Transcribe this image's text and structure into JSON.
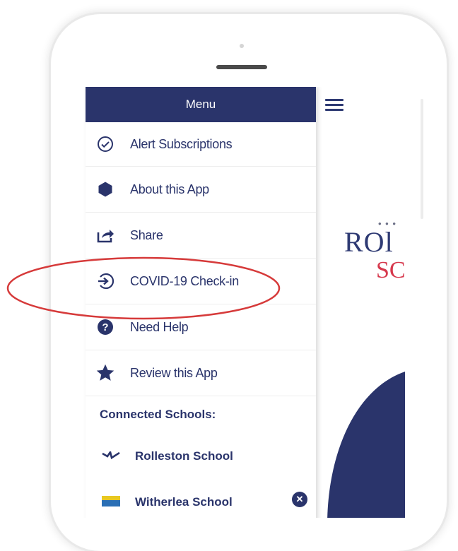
{
  "drawer": {
    "title": "Menu",
    "items": [
      {
        "label": "Alert Subscriptions",
        "icon": "check-circle-icon"
      },
      {
        "label": "About this App",
        "icon": "hexagon-icon"
      },
      {
        "label": "Share",
        "icon": "share-icon"
      },
      {
        "label": "COVID-19 Check-in",
        "icon": "sign-in-icon"
      },
      {
        "label": "Need Help",
        "icon": "question-icon"
      },
      {
        "label": "Review this App",
        "icon": "star-icon"
      }
    ],
    "connected_title": "Connected Schools:",
    "schools": [
      {
        "label": "Rolleston School",
        "icon": "school-logo-icon"
      },
      {
        "label": "Witherlea School",
        "icon": "school-logo-icon",
        "removable": true,
        "remove_glyph": "✕"
      }
    ]
  },
  "logo": {
    "line1": "ROl",
    "line2": "SC",
    "dots": "• • •"
  },
  "colors": {
    "primary": "#2a346b",
    "accent_red": "#d6384c",
    "highlight": "#d63a3a"
  }
}
